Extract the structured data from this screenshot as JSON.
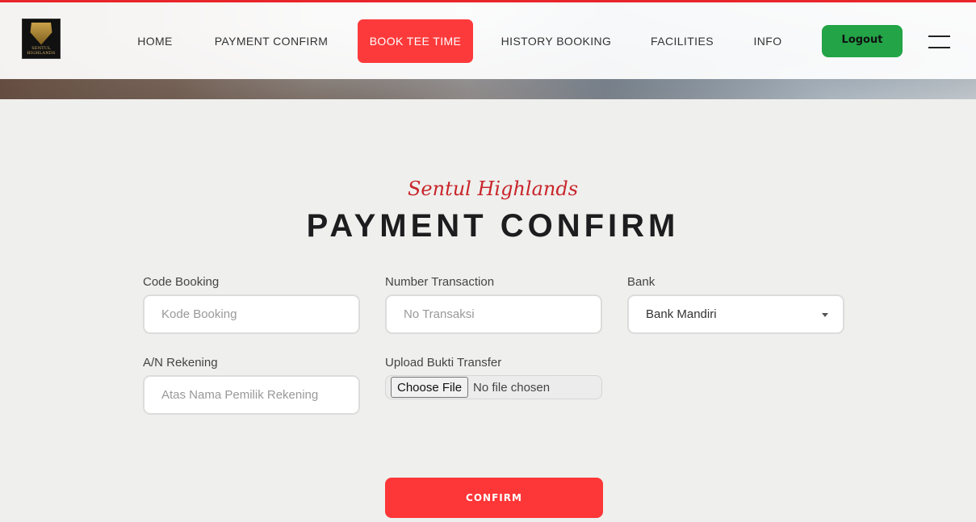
{
  "header": {
    "logo_text": "SENTUL HIGHLANDS",
    "nav": [
      {
        "label": "HOME"
      },
      {
        "label": "PAYMENT CONFIRM"
      },
      {
        "label": "BOOK TEE TIME"
      },
      {
        "label": "HISTORY BOOKING"
      },
      {
        "label": "FACILITIES"
      },
      {
        "label": "INFO"
      }
    ],
    "logout_label": "Logout",
    "menu_icon": "hamburger-menu-icon"
  },
  "colors": {
    "accent_red": "#fd3a3b",
    "logout_green": "#22a447",
    "subtitle_red": "#c8262b"
  },
  "page": {
    "subtitle": "Sentul Highlands",
    "title": "PAYMENT CONFIRM"
  },
  "form": {
    "code_booking": {
      "label": "Code Booking",
      "placeholder": "Kode Booking",
      "value": ""
    },
    "number_transaction": {
      "label": "Number Transaction",
      "placeholder": "No Transaksi",
      "value": ""
    },
    "bank": {
      "label": "Bank",
      "selected": "Bank Mandiri"
    },
    "account_name": {
      "label": "A/N Rekening",
      "placeholder": "Atas Nama Pemilik Rekening",
      "value": ""
    },
    "upload": {
      "label": "Upload Bukti Transfer",
      "button_label": "Choose File",
      "status": "No file chosen"
    },
    "confirm_label": "CONFIRM"
  }
}
